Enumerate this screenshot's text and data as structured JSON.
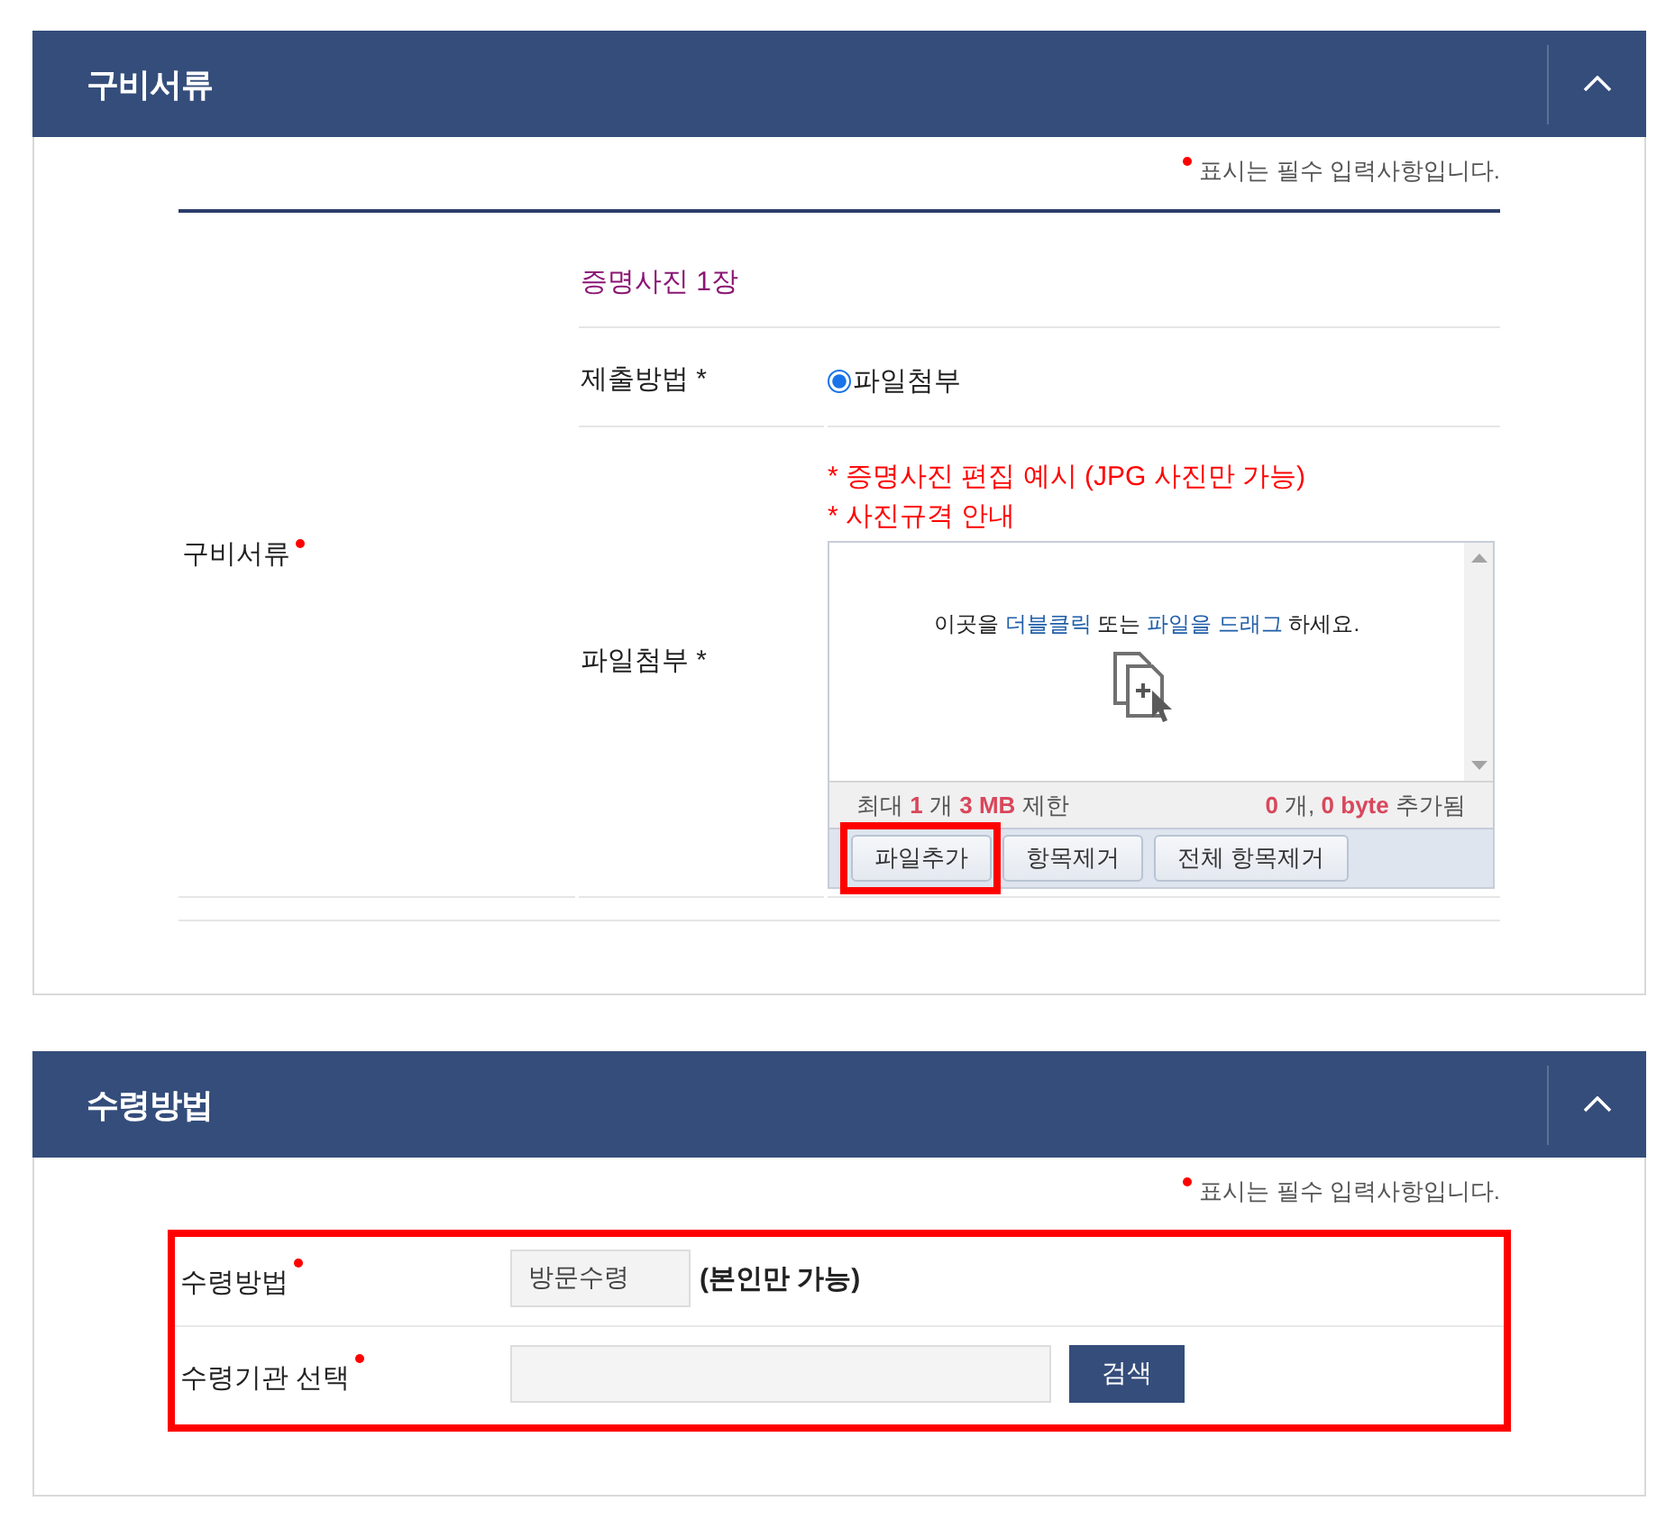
{
  "sections": [
    {
      "kind": "documents",
      "title": "구비서류",
      "expanded": true,
      "required_note": "표시는 필수 입력사항입니다.",
      "label": "구비서류",
      "required": true,
      "heading": "증명사진 1장",
      "submit_method": {
        "label": "제출방법 *",
        "options": [
          {
            "label": "파일첨부",
            "selected": true
          }
        ]
      },
      "attachment": {
        "label": "파일첨부 *",
        "guides": [
          "* 증명사진 편집 예시 (JPG 사진만 가능)",
          "* 사진규격 안내"
        ],
        "drop_hint": [
          {
            "text": "이곳을",
            "emphasis": false
          },
          {
            "text": "더블클릭",
            "emphasis": true
          },
          {
            "text": "또는",
            "emphasis": false
          },
          {
            "text": "파일을 드래그",
            "emphasis": true
          },
          {
            "text": "하세요.",
            "emphasis": false
          }
        ],
        "limit": [
          {
            "text": "최대",
            "emphasis": false
          },
          {
            "text": "1",
            "emphasis": true
          },
          {
            "text": "개",
            "emphasis": false
          },
          {
            "text": "3 MB",
            "emphasis": true
          },
          {
            "text": "제한",
            "emphasis": false
          }
        ],
        "status": [
          {
            "text": "0",
            "emphasis": true
          },
          {
            "text": "개,",
            "emphasis": false
          },
          {
            "text": "0 byte",
            "emphasis": true
          },
          {
            "text": "추가됨",
            "emphasis": false
          }
        ],
        "buttons": [
          {
            "label": "파일추가",
            "annotated": true
          },
          {
            "label": "항목제거",
            "annotated": false
          },
          {
            "label": "전체 항목제거",
            "annotated": false
          }
        ]
      }
    },
    {
      "kind": "pickup",
      "title": "수령방법",
      "expanded": true,
      "required_note": "표시는 필수 입력사항입니다.",
      "annotated": true,
      "rows": [
        {
          "kind": "readonly",
          "label": "수령방법",
          "required": true,
          "value": "방문수령",
          "suffix": "(본인만 가능)"
        },
        {
          "kind": "search",
          "label": "수령기관 선택",
          "required": true,
          "button": "검색"
        }
      ]
    }
  ]
}
